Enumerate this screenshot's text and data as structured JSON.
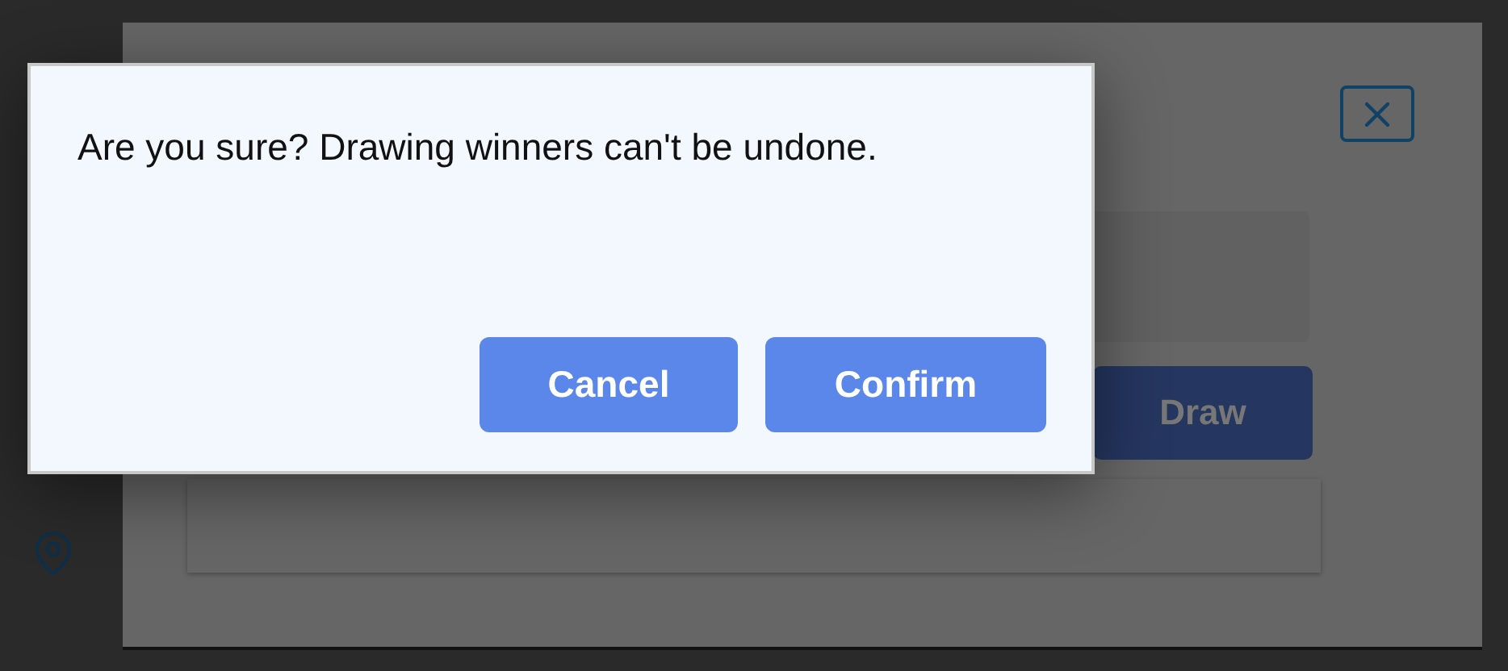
{
  "background_modal": {
    "draw_button": "Draw"
  },
  "confirm_dialog": {
    "message": "Are you sure? Drawing winners can't be undone.",
    "buttons": [
      {
        "label": "Cancel",
        "kind": "cancel"
      },
      {
        "label": "Confirm",
        "kind": "confirm"
      }
    ]
  }
}
